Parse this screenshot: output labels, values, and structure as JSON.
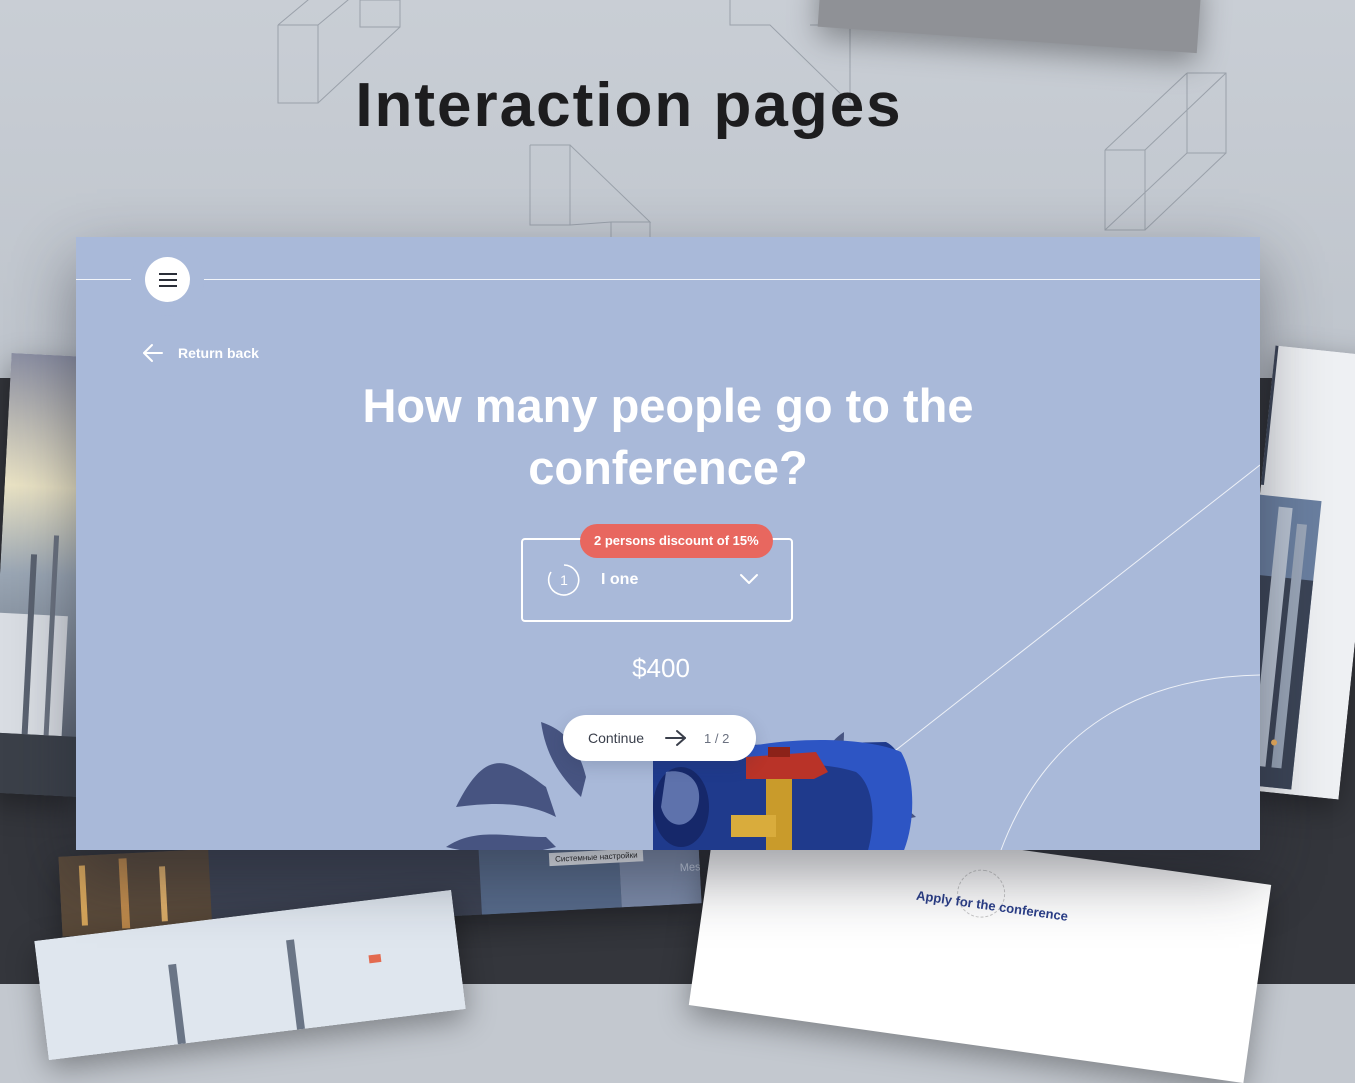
{
  "page": {
    "headline": "Interaction pages"
  },
  "card": {
    "return_back": "Return back",
    "question_line1": "How many people go to the",
    "question_line2": "conference?",
    "discount_badge": "2 persons discount of 15%",
    "select": {
      "number": "1",
      "selected": "I one"
    },
    "price": "$400",
    "continue_label": "Continue",
    "step_counter": "1 / 2"
  },
  "background": {
    "apply_text": "Apply for the conference",
    "system_settings": "Системные настройки",
    "partial_text": "Mes"
  },
  "icons": {
    "menu": "hamburger-icon",
    "back": "arrow-left-icon",
    "chevron": "chevron-down-icon",
    "continue": "arrow-right-icon"
  },
  "colors": {
    "card_background": "#a9b9d9",
    "badge": "#e8675f",
    "headline": "#1d1d1f",
    "dark_backdrop": "#34363c"
  }
}
